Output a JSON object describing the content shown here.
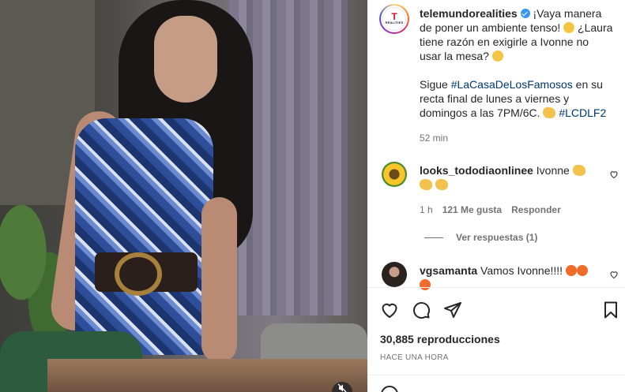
{
  "post": {
    "username": "telemundorealities",
    "avatar_logo_main": "T",
    "avatar_logo_sub": "REALITIES",
    "caption_line1": "¡Vaya manera de poner un ambiente tenso!",
    "caption_line2": "¿Laura tiene razón en exigirle a Ivonne no usar la mesa?",
    "caption_p2_a": "Sigue ",
    "caption_hashtag1": "#LaCasaDeLosFamosos",
    "caption_p2_b": " en su recta final de lunes a viernes y domingos a las 7PM/6C.",
    "caption_hashtag2": "#LCDLF2",
    "time": "52 min"
  },
  "comments": [
    {
      "username": "looks_tododiaonlinee",
      "text": "Ivonne",
      "time": "1 h",
      "likes": "121 Me gusta",
      "reply_label": "Responder",
      "view_replies": "Ver respuestas (1)"
    },
    {
      "username": "vgsamanta",
      "text": "Vamos Ivonne!!!!"
    }
  ],
  "footer": {
    "views": "30,885 reproducciones",
    "posted": "HACE UNA HORA"
  },
  "icons": {
    "like": "heart-icon",
    "comment": "comment-icon",
    "share": "share-icon",
    "save": "bookmark-icon",
    "mute": "mute-icon",
    "emoji": "smiley-icon"
  },
  "colors": {
    "link": "#00376b",
    "verified": "#3897f0",
    "muted_text": "#737373"
  }
}
